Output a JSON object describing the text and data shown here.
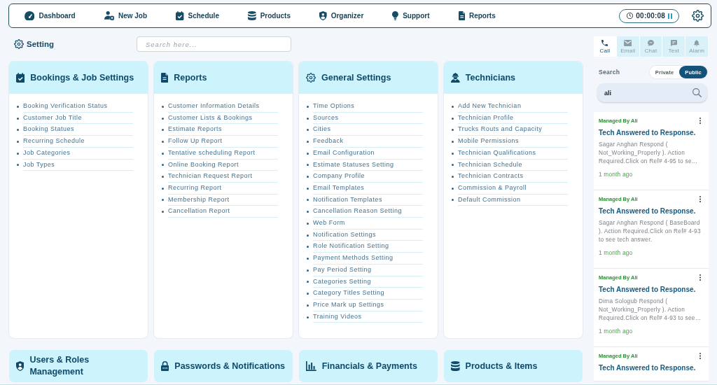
{
  "top_nav": {
    "items": [
      {
        "label": "Dashboard"
      },
      {
        "label": "New Job"
      },
      {
        "label": "Schedule"
      },
      {
        "label": "Products"
      },
      {
        "label": "Organizer"
      },
      {
        "label": "Support"
      },
      {
        "label": "Reports"
      }
    ],
    "timer": "00:00:08"
  },
  "page_header": {
    "title": "Setting",
    "search": {
      "placeholder": "Search here..."
    }
  },
  "cards": [
    {
      "title": "Bookings & Job Settings",
      "items": [
        "Booking Verification Status",
        "Customer Job Title",
        "Booking Statues",
        "Recurring Schedule",
        "Job Categories",
        "Job Types"
      ]
    },
    {
      "title": "Reports",
      "items": [
        "Customer Information Details",
        "Customer Lists & Bookings",
        "Estimate Reports",
        "Follow Up Report",
        "Tentative scheduling Report",
        "Online Booking Report",
        "Technician Request Report",
        "Recurring Report",
        "Membership Report",
        "Cancellation Report"
      ]
    },
    {
      "title": "General Settings",
      "items": [
        "Time Options",
        "Sources",
        "Cities",
        "Feedback",
        "Email Configuration",
        "Estimate Statuses Setting",
        "Company Profile",
        "Email Templates",
        "Notification Templates",
        "Cancellation Reason Setting",
        "Web Form",
        "Notification Settings",
        "Role Notification Setting",
        "Payment Methods Setting",
        "Pay Period Setting",
        "Categories Setting",
        "Category Titles Setting",
        "Price Mark up Settings",
        "Training Videos"
      ]
    },
    {
      "title": "Technicians",
      "items": [
        "Add New Technician",
        "Technician Profile",
        "Trucks Routs and Capacity",
        "Mobile Permissions",
        "Technician Qualifications",
        "Technician Schedule",
        "Technician Contracts",
        "Commission & Payroll",
        "Default Commission"
      ]
    },
    {
      "title": "Users & Roles Management"
    },
    {
      "title": "Passwords & Notifications"
    },
    {
      "title": "Financials & Payments"
    },
    {
      "title": "Products & Items"
    }
  ],
  "side_panel": {
    "tabs": [
      {
        "label": "Call",
        "selected": true
      },
      {
        "label": "Email",
        "selected": false
      },
      {
        "label": "Chat",
        "selected": false
      },
      {
        "label": "Text",
        "selected": false
      },
      {
        "label": "Alarm",
        "selected": false
      }
    ],
    "search_label": "Search",
    "visibility": [
      {
        "label": "Private",
        "selected": false
      },
      {
        "label": "Public",
        "selected": true
      }
    ],
    "search": {
      "value": "ali"
    },
    "notifications": [
      {
        "manager": "Managed By Ali",
        "title": "Tech Answered to Response.",
        "message": "Sagar Anghan Respond ( Not_Working_Properly ). Action Required.Click on Ref# 4-95 to se…",
        "time": "1 month ago"
      },
      {
        "manager": "Managed By Ali",
        "title": "Tech Answered to Response.",
        "message": "Sagar Anghan Respond ( BaseBoard ). Action Required.Click on Ref# 4-93 to see tech answer.",
        "time": "1 month ago"
      },
      {
        "manager": "Managed By Ali",
        "title": "Tech Answered to Response.",
        "message": "Dima Sologub Respond ( Not_Working_Properly ). Action Required.Click on Ref# 4-93 to see…",
        "time": "1 month ago"
      },
      {
        "manager": "Managed By Ali",
        "title": "Tech Answered to Response."
      }
    ]
  }
}
